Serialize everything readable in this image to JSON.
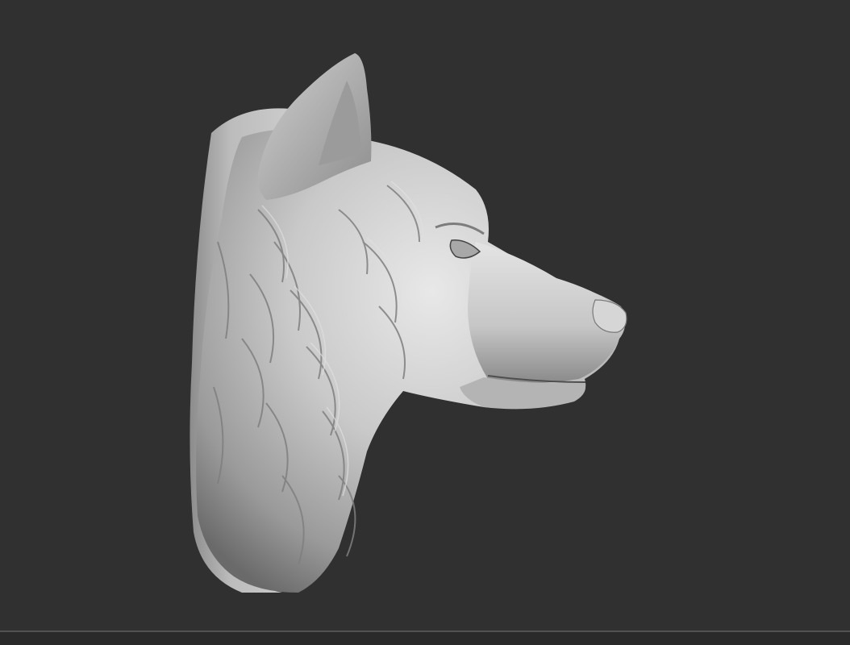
{
  "viewport": {
    "background_color": "#303030",
    "model": {
      "subject": "wolf-head-sculpt",
      "material_color": "#bdbdbd",
      "highlight_color": "#e6e6e6",
      "shadow_color": "#5a5a5a"
    }
  },
  "bottom_bar": {
    "divider_color": "#525252",
    "background_color": "#2a2a2a"
  }
}
